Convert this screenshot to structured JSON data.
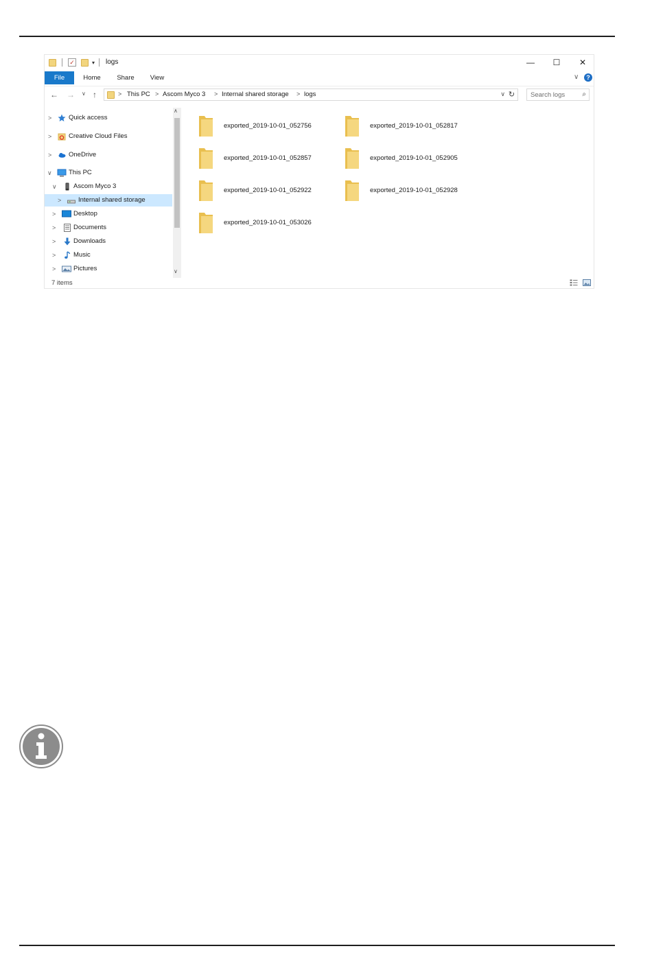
{
  "window": {
    "title": "logs",
    "controls": {
      "minimize": "—",
      "maximize": "☐",
      "close": "✕"
    }
  },
  "ribbon": {
    "tabs": [
      "File",
      "Home",
      "Share",
      "View"
    ],
    "collapse_glyph": "∨",
    "help_glyph": "?"
  },
  "address": {
    "path": [
      "This PC",
      "Ascom Myco 3",
      "Internal shared storage",
      "logs"
    ],
    "separator": ">",
    "refresh_glyph": "↻",
    "search_placeholder": "Search logs"
  },
  "nav": {
    "back": "←",
    "forward": "→",
    "recent": "∨",
    "up": "↑"
  },
  "navpane": {
    "items": [
      {
        "label": "Quick access",
        "icon": "quick-access-star-icon",
        "selected": false
      },
      {
        "label": "Creative Cloud Files",
        "icon": "creative-cloud-icon",
        "selected": false
      },
      {
        "label": "OneDrive",
        "icon": "onedrive-cloud-icon",
        "selected": false
      },
      {
        "label": "This PC",
        "icon": "this-pc-icon",
        "selected": false
      },
      {
        "label": "Ascom Myco 3",
        "icon": "phone-device-icon",
        "selected": false
      },
      {
        "label": "Internal shared storage",
        "icon": "storage-drive-icon",
        "selected": true
      },
      {
        "label": "Desktop",
        "icon": "desktop-icon",
        "selected": false
      },
      {
        "label": "Documents",
        "icon": "documents-icon",
        "selected": false
      },
      {
        "label": "Downloads",
        "icon": "downloads-icon",
        "selected": false
      },
      {
        "label": "Music",
        "icon": "music-icon",
        "selected": false
      },
      {
        "label": "Pictures",
        "icon": "pictures-icon",
        "selected": false
      }
    ]
  },
  "folders": [
    "exported_2019-10-01_052756",
    "exported_2019-10-01_052817",
    "exported_2019-10-01_052857",
    "exported_2019-10-01_052905",
    "exported_2019-10-01_052922",
    "exported_2019-10-01_052928",
    "exported_2019-10-01_053026"
  ],
  "status": {
    "item_count": "7 items"
  },
  "colors": {
    "file_tab": "#1979ca",
    "selection": "#cce8ff",
    "folder": "#f2d57e",
    "rule": "#1e1e1e",
    "info_badge": "#8c8c8c"
  }
}
